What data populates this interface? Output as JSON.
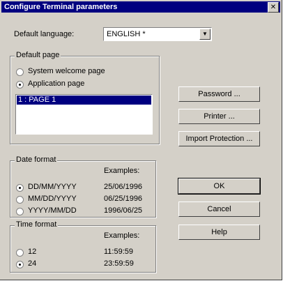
{
  "window": {
    "title": "Configure Terminal parameters",
    "close_glyph": "✕"
  },
  "language": {
    "label": "Default language:",
    "value": "ENGLISH *",
    "drop_glyph": "▼"
  },
  "default_page": {
    "legend": "Default page",
    "options": [
      {
        "label": "System welcome page",
        "checked": false
      },
      {
        "label": "Application page",
        "checked": true
      }
    ],
    "list": {
      "selected_item": "1 : PAGE 1"
    }
  },
  "date_format": {
    "legend": "Date format",
    "examples_header": "Examples:",
    "options": [
      {
        "label": "DD/MM/YYYY",
        "example": "25/06/1996",
        "checked": true
      },
      {
        "label": "MM/DD/YYYY",
        "example": "06/25/1996",
        "checked": false
      },
      {
        "label": "YYYY/MM/DD",
        "example": "1996/06/25",
        "checked": false
      }
    ]
  },
  "time_format": {
    "legend": "Time format",
    "examples_header": "Examples:",
    "options": [
      {
        "label": "12",
        "example": "11:59:59",
        "checked": false
      },
      {
        "label": "24",
        "example": "23:59:59",
        "checked": true
      }
    ]
  },
  "buttons": {
    "password": "Password ...",
    "printer": "Printer ...",
    "import_protection": "Import Protection ...",
    "ok": "OK",
    "cancel": "Cancel",
    "help": "Help"
  }
}
